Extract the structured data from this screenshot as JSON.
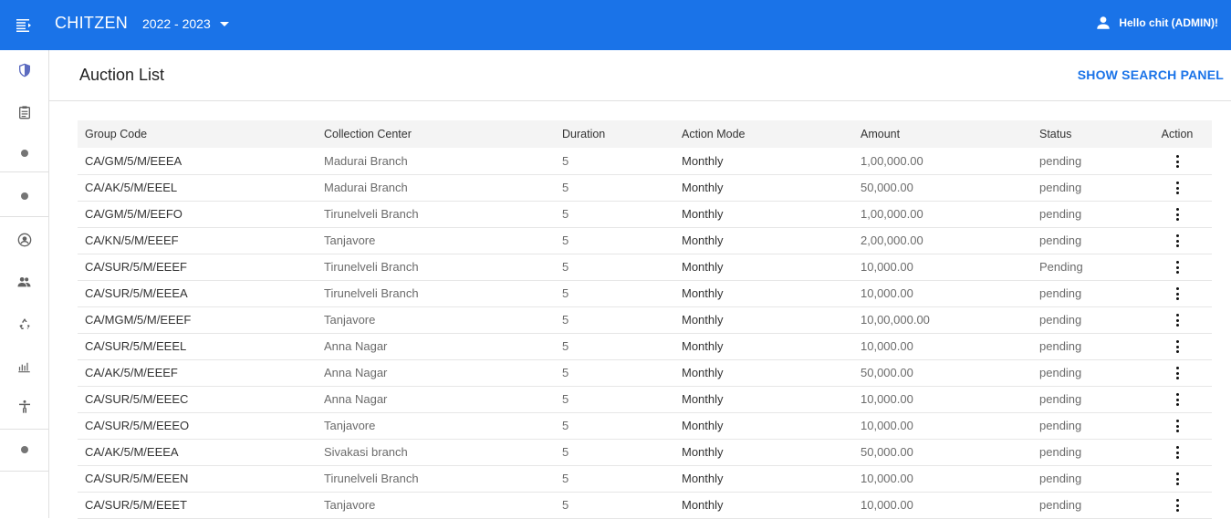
{
  "app": {
    "brand": "CHITZEN",
    "year": "2022 - 2023",
    "user_greeting": "Hello chit (ADMIN)!"
  },
  "colors": {
    "primary": "#1a73e8",
    "sidebar_icon": "#5c6bc0"
  },
  "sidebar": {
    "items": [
      {
        "icon": "shield-icon"
      },
      {
        "icon": "clipboard-icon"
      },
      {
        "icon": "dot-icon"
      },
      {
        "icon": "dot-icon"
      },
      {
        "icon": "account-circle-icon"
      },
      {
        "icon": "people-icon"
      },
      {
        "icon": "recycle-icon"
      },
      {
        "icon": "bar-chart-icon"
      },
      {
        "icon": "accessibility-icon"
      },
      {
        "icon": "dot-icon"
      }
    ]
  },
  "page": {
    "title": "Auction List",
    "search_panel_label": "SHOW SEARCH PANEL"
  },
  "table": {
    "headers": {
      "group_code": "Group Code",
      "collection_center": "Collection Center",
      "duration": "Duration",
      "action_mode": "Action Mode",
      "amount": "Amount",
      "status": "Status",
      "action": "Action"
    },
    "rows": [
      {
        "group_code": "CA/GM/5/M/EEEA",
        "collection_center": "Madurai Branch",
        "duration": "5",
        "action_mode": "Monthly",
        "amount": "1,00,000.00",
        "status": "pending"
      },
      {
        "group_code": "CA/AK/5/M/EEEL",
        "collection_center": "Madurai Branch",
        "duration": "5",
        "action_mode": "Monthly",
        "amount": "50,000.00",
        "status": "pending"
      },
      {
        "group_code": "CA/GM/5/M/EEFO",
        "collection_center": "Tirunelveli Branch",
        "duration": "5",
        "action_mode": "Monthly",
        "amount": "1,00,000.00",
        "status": "pending"
      },
      {
        "group_code": "CA/KN/5/M/EEEF",
        "collection_center": "Tanjavore",
        "duration": "5",
        "action_mode": "Monthly",
        "amount": "2,00,000.00",
        "status": "pending"
      },
      {
        "group_code": "CA/SUR/5/M/EEEF",
        "collection_center": "Tirunelveli Branch",
        "duration": "5",
        "action_mode": "Monthly",
        "amount": "10,000.00",
        "status": "Pending"
      },
      {
        "group_code": "CA/SUR/5/M/EEEA",
        "collection_center": "Tirunelveli Branch",
        "duration": "5",
        "action_mode": "Monthly",
        "amount": "10,000.00",
        "status": "pending"
      },
      {
        "group_code": "CA/MGM/5/M/EEEF",
        "collection_center": "Tanjavore",
        "duration": "5",
        "action_mode": "Monthly",
        "amount": "10,00,000.00",
        "status": "pending"
      },
      {
        "group_code": "CA/SUR/5/M/EEEL",
        "collection_center": "Anna Nagar",
        "duration": "5",
        "action_mode": "Monthly",
        "amount": "10,000.00",
        "status": "pending"
      },
      {
        "group_code": "CA/AK/5/M/EEEF",
        "collection_center": "Anna Nagar",
        "duration": "5",
        "action_mode": "Monthly",
        "amount": "50,000.00",
        "status": "pending"
      },
      {
        "group_code": "CA/SUR/5/M/EEEC",
        "collection_center": "Anna Nagar",
        "duration": "5",
        "action_mode": "Monthly",
        "amount": "10,000.00",
        "status": "pending"
      },
      {
        "group_code": "CA/SUR/5/M/EEEO",
        "collection_center": "Tanjavore",
        "duration": "5",
        "action_mode": "Monthly",
        "amount": "10,000.00",
        "status": "pending"
      },
      {
        "group_code": "CA/AK/5/M/EEEA",
        "collection_center": "Sivakasi branch",
        "duration": "5",
        "action_mode": "Monthly",
        "amount": "50,000.00",
        "status": "pending"
      },
      {
        "group_code": "CA/SUR/5/M/EEEN",
        "collection_center": "Tirunelveli Branch",
        "duration": "5",
        "action_mode": "Monthly",
        "amount": "10,000.00",
        "status": "pending"
      },
      {
        "group_code": "CA/SUR/5/M/EEET",
        "collection_center": "Tanjavore",
        "duration": "5",
        "action_mode": "Monthly",
        "amount": "10,000.00",
        "status": "pending"
      }
    ]
  }
}
